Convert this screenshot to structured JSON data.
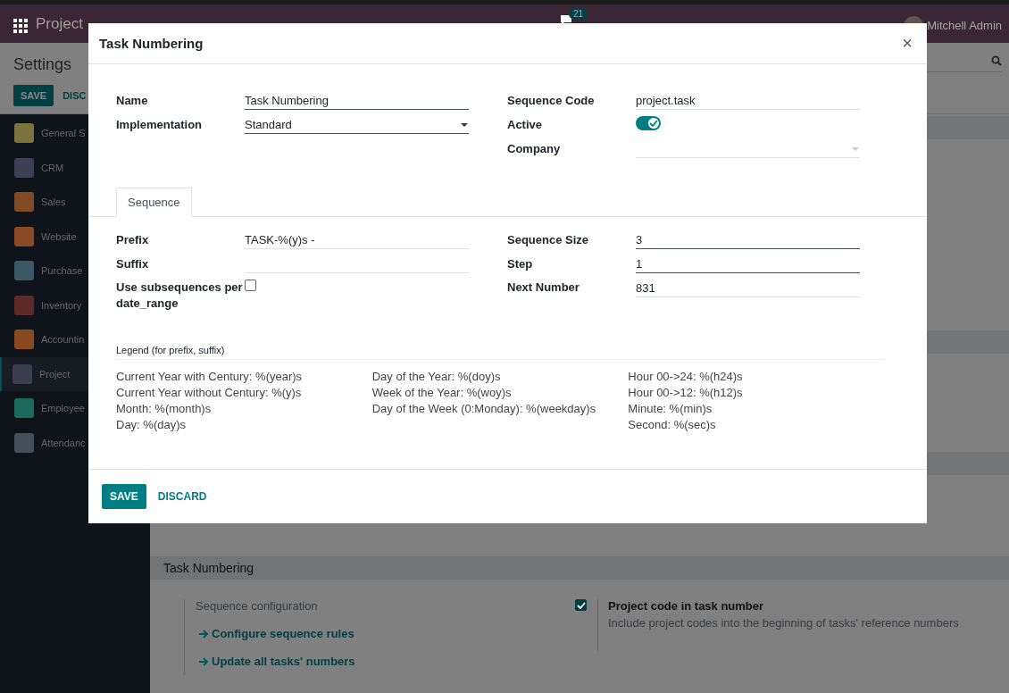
{
  "navbar": {
    "app_name": "Project",
    "message_count": "21",
    "user_name": "Mitchell Admin"
  },
  "control_panel": {
    "title": "Settings",
    "buttons": [
      {
        "label": "SAVE",
        "kind": "primary"
      },
      {
        "label": "DISC",
        "kind": "secondary"
      }
    ]
  },
  "sidebar": {
    "items": [
      {
        "label": "General S",
        "color": "#7d7340",
        "selected": false
      },
      {
        "label": "CRM",
        "color": "#3e3f55",
        "selected": false
      },
      {
        "label": "Sales",
        "color": "#7f4a24",
        "selected": false
      },
      {
        "label": "Website",
        "color": "#8a4a25",
        "selected": false
      },
      {
        "label": "Purchase",
        "color": "#3c5866",
        "selected": false
      },
      {
        "label": "Inventory",
        "color": "#5e2a28",
        "selected": false
      },
      {
        "label": "Accountin",
        "color": "#8a4a1f",
        "selected": false
      },
      {
        "label": "Project",
        "color": "#3d3d50",
        "selected": true
      },
      {
        "label": "Employee",
        "color": "#1c6a5d",
        "selected": false
      },
      {
        "label": "Attendanc",
        "color": "#454f5a",
        "selected": false
      }
    ]
  },
  "settings": {
    "section_title": "Task Numbering",
    "setting_label": "Sequence configuration",
    "links": [
      "Configure sequence rules",
      "Update all tasks' numbers"
    ],
    "option": {
      "label": "Project code in task number",
      "description": "Include project codes into the beginning of tasks' reference numbers",
      "checked": true
    }
  },
  "dialog": {
    "title": "Task Numbering",
    "close": "×",
    "left_fields": [
      {
        "label": "Name",
        "kind": "text",
        "value": "Task Numbering",
        "required": true
      },
      {
        "label": "Implementation",
        "kind": "select",
        "value": "Standard",
        "required": true
      }
    ],
    "right_fields": [
      {
        "label": "Sequence Code",
        "kind": "text",
        "value": "project.task",
        "required": false
      },
      {
        "label": "Active",
        "kind": "toggle",
        "on": true
      },
      {
        "label": "Company",
        "kind": "select",
        "required": false
      }
    ],
    "tabs": [
      {
        "label": "Sequence",
        "selected": true
      }
    ],
    "tab_left_fields": [
      {
        "label": "Prefix",
        "kind": "text",
        "value": "TASK-%(y)s -",
        "required": false
      },
      {
        "label": "Suffix",
        "kind": "text",
        "required": false
      },
      {
        "label": "Use subsequences per date_range",
        "kind": "checkbox",
        "checked": false
      }
    ],
    "tab_right_fields": [
      {
        "label": "Sequence Size",
        "kind": "text",
        "value": "3",
        "required": true
      },
      {
        "label": "Step",
        "kind": "text",
        "value": "1",
        "required": true
      },
      {
        "label": "Next Number",
        "kind": "text",
        "value": "831",
        "required": false
      }
    ],
    "legend": {
      "title": "Legend (for prefix, suffix)",
      "columns": [
        [
          "Current Year with Century: %(year)s",
          "Current Year without Century: %(y)s",
          "Month: %(month)s",
          "Day: %(day)s"
        ],
        [
          "Day of the Year: %(doy)s",
          "Week of the Year: %(woy)s",
          "Day of the Week (0:Monday): %(weekday)s"
        ],
        [
          "Hour 00->24: %(h24)s",
          "Hour 00->12: %(h12)s",
          "Minute: %(min)s",
          "Second: %(sec)s"
        ]
      ]
    },
    "buttons": [
      {
        "label": "SAVE",
        "kind": "primary"
      },
      {
        "label": "DISCARD",
        "kind": "secondary"
      }
    ]
  }
}
